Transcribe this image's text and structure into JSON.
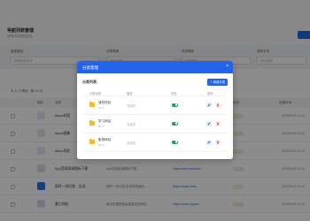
{
  "background": {
    "page_title": "导航列表管理",
    "page_subtitle": "管理网站导航链接",
    "filters": [
      {
        "label": "链接搜索",
        "placeholder": "搜索链接名称"
      },
      {
        "label": "分类筛选",
        "value": "全部分类"
      },
      {
        "label": "状态筛选",
        "value": "全部状态"
      },
      {
        "label": "排序方式",
        "value": "综合排序"
      }
    ],
    "pager_text": "共 11 个网站 · 第 1/1 页",
    "columns": [
      "图标",
      "名称",
      "描述",
      "链接",
      "分类",
      "状态",
      "创建时间"
    ],
    "rows": [
      {
        "name": "Aicon封面",
        "desc": "",
        "link": "",
        "date": "2025/02/09 21:03"
      },
      {
        "name": "Aicon图集",
        "desc": "",
        "link": "",
        "date": "2025/02/09 21:03"
      },
      {
        "name": "Aicon导航",
        "desc": "",
        "link": "",
        "date": "2025/02/09 21:03"
      },
      {
        "name": "App官网高清图标下载",
        "desc": "App官网高清图标下载",
        "link": "https://www.iconfont...",
        "date": "2025/02/09 21:03"
      },
      {
        "name": "即时一刻问答、告诉...",
        "desc": "即时一刻问答,告诉你答案的...",
        "link": "https://www.zhihu...",
        "date": "2025/02/09 21:03"
      },
      {
        "name": "魔力导航",
        "desc": "魔法效果是做高质量优化网站...",
        "link": "https://www.mgnav...",
        "date": "2025/02/09 21:03"
      }
    ]
  },
  "modal": {
    "title": "分类管理",
    "close_glyph": "×",
    "list_title": "分类列表",
    "add_button": "新增分类",
    "add_icon_glyph": "+",
    "columns": [
      "分类名称",
      "描述",
      "状态",
      "操作"
    ],
    "categories": [
      {
        "name": "我的项目",
        "id": "ID: 1",
        "desc": "无描述",
        "enabled": true
      },
      {
        "name": "学习网站",
        "id": "ID: 2",
        "desc": "无描述",
        "enabled": true
      },
      {
        "name": "影视网站",
        "id": "ID: 3",
        "desc": "无描述",
        "enabled": true
      }
    ]
  },
  "colors": {
    "primary": "#2463eb",
    "enabled": "#1f9d55",
    "danger": "#e53e3e",
    "folder": "#f6b91f"
  }
}
